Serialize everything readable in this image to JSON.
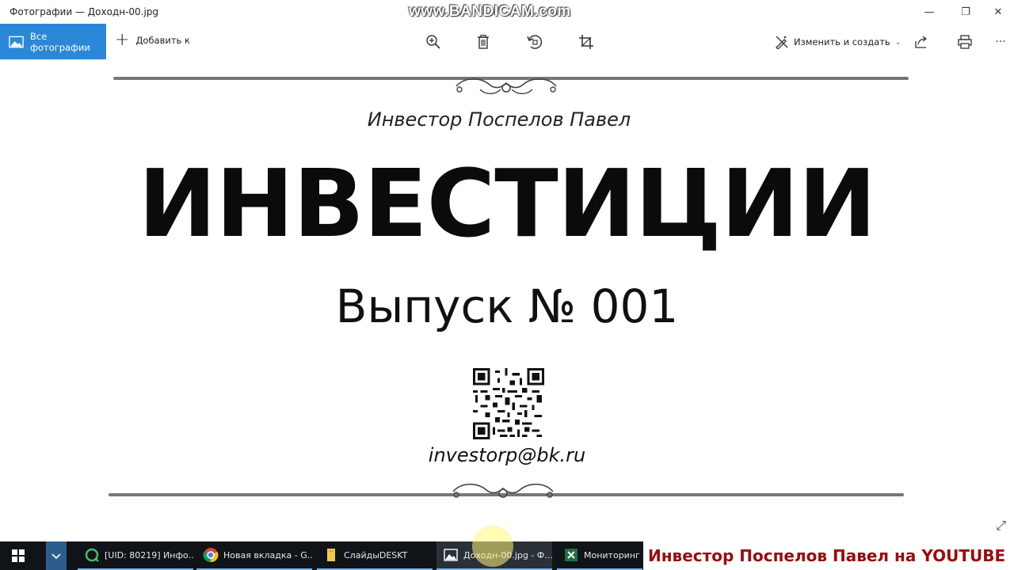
{
  "window": {
    "title": "Фотографии — Доходн-00.jpg",
    "watermark": "www.BANDICAM.com",
    "controls": {
      "minimize": "—",
      "restore": "❐",
      "close": "✕"
    }
  },
  "toolbar": {
    "all_photos_label": "Все фотографии",
    "add_to_label": "Добавить к",
    "tools": [
      "zoom-in-icon",
      "delete-icon",
      "rotate-icon",
      "crop-icon"
    ],
    "edit_create_label": "Изменить и создать",
    "more_label": "···"
  },
  "image": {
    "author": "Инвестор Поспелов Павел",
    "headline": "ИНВЕСТИЦИИ",
    "issue": "Выпуск № 001",
    "email": "investorp@bk.ru"
  },
  "taskbar": {
    "items": [
      {
        "label": "[UID: 80219] Инфо...",
        "icon": "app-green-icon"
      },
      {
        "label": "Новая вкладка - G...",
        "icon": "chrome-icon"
      },
      {
        "label": "СлайдыDESKT",
        "icon": "folder-icon"
      },
      {
        "label": "Доходн-00.jpg - Ф...",
        "icon": "photos-icon"
      },
      {
        "label": "Мониторинг -",
        "icon": "excel-icon"
      }
    ],
    "banner": "Инвестор Поспелов Павел на YOUTUBE"
  }
}
